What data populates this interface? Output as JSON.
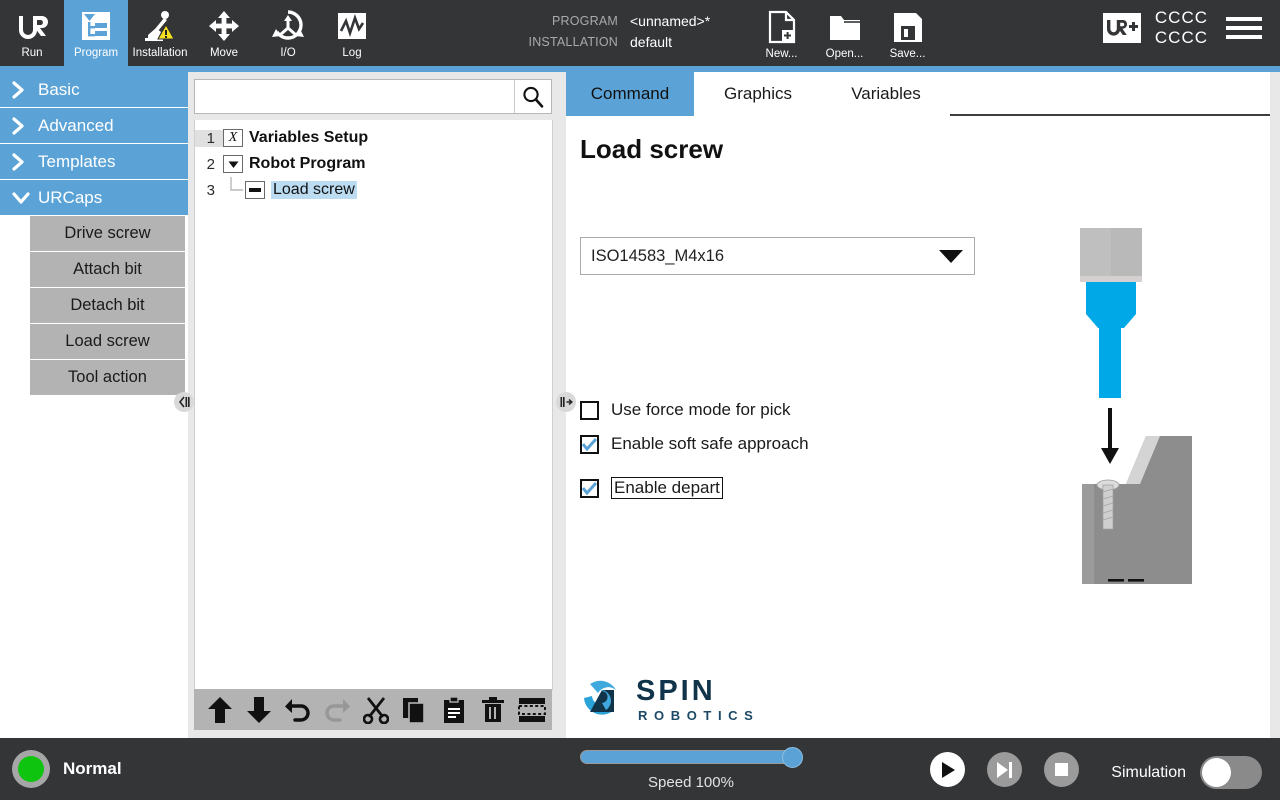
{
  "header": {
    "nav_tabs": [
      {
        "label": "Run",
        "icon": "ur-logo-icon",
        "active": false
      },
      {
        "label": "Program",
        "icon": "program-tree-icon",
        "active": true
      },
      {
        "label": "Installation",
        "icon": "robot-warning-icon",
        "active": false
      },
      {
        "label": "Move",
        "icon": "move-arrows-icon",
        "active": false
      },
      {
        "label": "I/O",
        "icon": "io-icon",
        "active": false
      },
      {
        "label": "Log",
        "icon": "log-graph-icon",
        "active": false
      }
    ],
    "meta": [
      {
        "key": "PROGRAM",
        "value": "<unnamed>*"
      },
      {
        "key": "INSTALLATION",
        "value": "default"
      }
    ],
    "actions": [
      {
        "label": "New...",
        "icon": "new-file-icon"
      },
      {
        "label": "Open...",
        "icon": "open-folder-icon"
      },
      {
        "label": "Save...",
        "icon": "save-floppy-icon"
      }
    ],
    "urplus_badge": "UR+",
    "account_line1": "CCCC",
    "account_line2": "CCCC",
    "menu_icon": "hamburger-menu-icon"
  },
  "sidebar": {
    "groups": [
      {
        "label": "Basic",
        "expanded": false
      },
      {
        "label": "Advanced",
        "expanded": false
      },
      {
        "label": "Templates",
        "expanded": false
      },
      {
        "label": "URCaps",
        "expanded": true
      }
    ],
    "urcaps_items": [
      {
        "label": "Drive screw"
      },
      {
        "label": "Attach bit"
      },
      {
        "label": "Detach bit"
      },
      {
        "label": "Load screw"
      },
      {
        "label": "Tool action"
      }
    ],
    "collapse_icon": "collapse-left-icon"
  },
  "tree_panel": {
    "search": {
      "value": "",
      "placeholder": ""
    },
    "search_icon": "search-icon",
    "rows": [
      {
        "num": "1",
        "icon": "variables-x-icon",
        "label": "Variables Setup",
        "indent": 0,
        "selected": false,
        "bold": true
      },
      {
        "num": "2",
        "icon": "expand-triangle-icon",
        "label": "Robot Program",
        "indent": 0,
        "selected": false,
        "bold": true
      },
      {
        "num": "3",
        "icon": "node-dash-icon",
        "label": "Load screw",
        "indent": 1,
        "selected": true,
        "bold": false
      }
    ],
    "toolbar": [
      {
        "name": "move-up-button",
        "icon": "arrow-up-icon",
        "disabled": false
      },
      {
        "name": "move-down-button",
        "icon": "arrow-down-icon",
        "disabled": false
      },
      {
        "name": "undo-button",
        "icon": "undo-icon",
        "disabled": false
      },
      {
        "name": "redo-button",
        "icon": "redo-icon",
        "disabled": true
      },
      {
        "name": "cut-button",
        "icon": "scissors-icon",
        "disabled": false
      },
      {
        "name": "copy-button",
        "icon": "copy-icon",
        "disabled": false
      },
      {
        "name": "paste-button",
        "icon": "clipboard-paste-icon",
        "disabled": false
      },
      {
        "name": "delete-button",
        "icon": "trash-icon",
        "disabled": false
      },
      {
        "name": "suppress-button",
        "icon": "suppress-icon",
        "disabled": false
      }
    ],
    "resize_icon": "panel-resize-icon"
  },
  "main": {
    "tabs": [
      {
        "label": "Command",
        "active": true
      },
      {
        "label": "Graphics",
        "active": false
      },
      {
        "label": "Variables",
        "active": false
      }
    ],
    "title": "Load screw",
    "screw_select": {
      "value": "ISO14583_M4x16",
      "caret_icon": "chevron-down-icon"
    },
    "checkboxes": [
      {
        "label": "Use force mode for pick",
        "checked": false,
        "focused": false
      },
      {
        "label": "Enable soft safe approach",
        "checked": true,
        "focused": false
      },
      {
        "label": "Enable depart",
        "checked": true,
        "focused": true
      }
    ],
    "illustration": "screw-pick-place-diagram",
    "logo": {
      "name": "SPIN",
      "tagline": "ROBOTICS"
    }
  },
  "footer": {
    "robot_status": "Normal",
    "status_led_color": "#0ec40e",
    "speed_label": "Speed 100%",
    "speed_percent": 100,
    "transport": [
      {
        "name": "play-button",
        "icon": "play-icon"
      },
      {
        "name": "step-button",
        "icon": "step-icon"
      },
      {
        "name": "stop-button",
        "icon": "stop-icon"
      }
    ],
    "simulation_label": "Simulation",
    "simulation_on": false
  },
  "theme": {
    "accent_blue": "#5ba3d7",
    "dark_bar": "#333537",
    "selection_blue": "#bcdcf2",
    "sidebar_sub_gray": "#b3b3b3"
  }
}
